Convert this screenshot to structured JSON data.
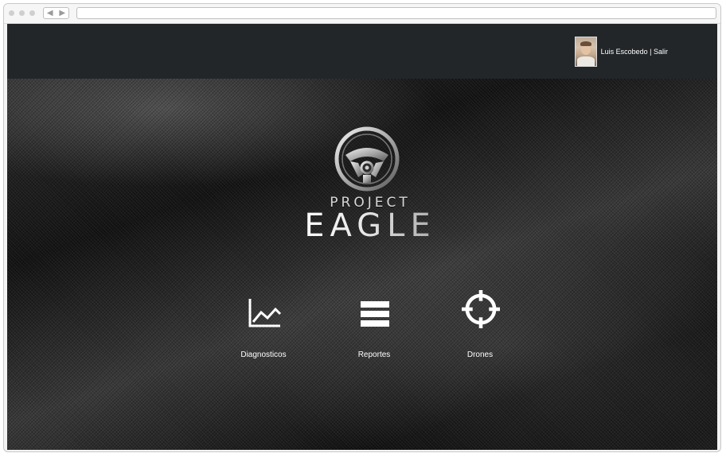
{
  "user": {
    "name_and_logout": "Luis Escobedo | Salir"
  },
  "logo": {
    "line1": "PROJECT",
    "line2": "EAGLE"
  },
  "menu": [
    {
      "label": "Diagnosticos",
      "icon": "line-chart-icon"
    },
    {
      "label": "Reportes",
      "icon": "list-bars-icon"
    },
    {
      "label": "Drones",
      "icon": "crosshair-icon"
    }
  ]
}
